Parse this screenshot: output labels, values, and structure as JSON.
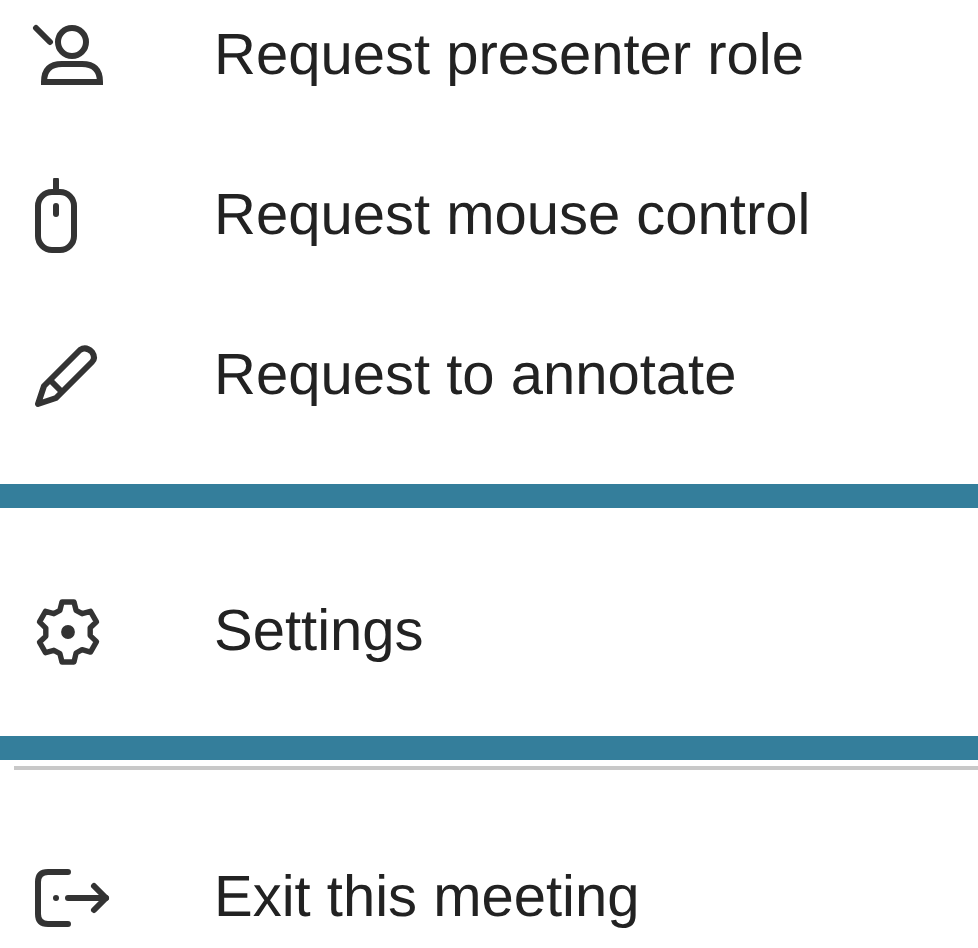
{
  "menu": {
    "groups": [
      {
        "items": [
          {
            "kind": "presenter",
            "label": "Request presenter role",
            "selected": false
          },
          {
            "kind": "mouse",
            "label": "Request mouse control",
            "selected": false
          },
          {
            "kind": "annotate",
            "label": "Request to annotate",
            "selected": false
          }
        ]
      },
      {
        "items": [
          {
            "kind": "settings",
            "label": "Settings",
            "selected": true
          }
        ]
      },
      {
        "items": [
          {
            "kind": "exit",
            "label": "Exit this meeting",
            "selected": false
          }
        ]
      }
    ]
  }
}
